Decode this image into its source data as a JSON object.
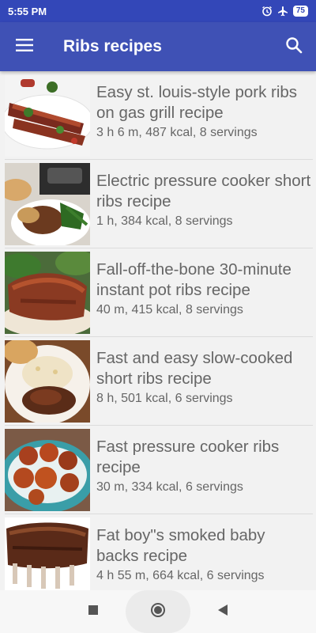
{
  "status": {
    "time": "5:55 PM",
    "battery": "75"
  },
  "app_bar": {
    "title": "Ribs recipes"
  },
  "recipes": [
    {
      "title": "Easy st. louis-style pork ribs on gas grill recipe",
      "meta": "3 h 6 m, 487 kcal, 8 servings"
    },
    {
      "title": "Electric pressure cooker short ribs recipe",
      "meta": "1 h, 384 kcal, 8 servings"
    },
    {
      "title": "Fall-off-the-bone 30-minute instant pot ribs recipe",
      "meta": "40 m, 415 kcal, 8 servings"
    },
    {
      "title": "Fast and easy slow-cooked short ribs recipe",
      "meta": "8 h, 501 kcal, 6 servings"
    },
    {
      "title": "Fast pressure cooker ribs recipe",
      "meta": "30 m, 334 kcal, 6 servings"
    },
    {
      "title": "Fat boy\"s smoked baby backs recipe",
      "meta": "4 h 55 m, 664 kcal, 6 servings"
    }
  ],
  "colors": {
    "app_bar": "#3f51b5",
    "status_bar": "#3347b8",
    "text": "#666666"
  }
}
